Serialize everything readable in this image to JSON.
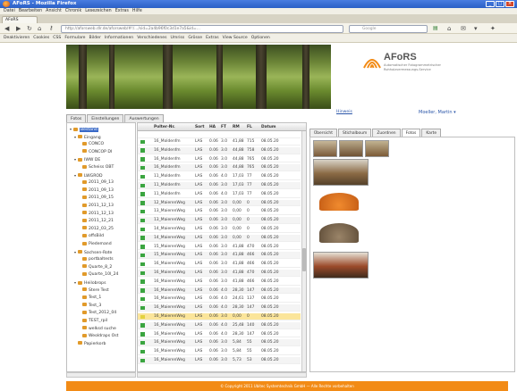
{
  "browser": {
    "title": "AFoRS - Mozilla Firefox",
    "menu": [
      "Datei",
      "Bearbeiten",
      "Ansicht",
      "Chronik",
      "Lesezeichen",
      "Extras",
      "Hilfe"
    ],
    "tab_label": "AFoRS",
    "url": "http://aforsweb.dlr.de/aforsweb/#!/.../sid=2a4b96f0c3d1e7a5&id=...",
    "search_placeholder": "Google",
    "bookmarks": [
      "Deaktivieren",
      "Cookies",
      "CSS",
      "Formulare",
      "Bilder",
      "Informationen",
      "Verschiedenes",
      "Umriss",
      "Grösse",
      "Extras",
      "View Source",
      "Optionen"
    ]
  },
  "header": {
    "logo_name": "AFoRS",
    "logo_sub": "Automatischer Fotogrammetrischer Rohholzvermessungs-Service",
    "small_link": "Hinweis",
    "user": "Moeller, Martin ▾"
  },
  "nav_tabs": [
    "Fotos",
    "Einstellungen",
    "Auswertungen"
  ],
  "tree": [
    {
      "label": "Bestand",
      "indent": 0,
      "selected": true,
      "expanded": true
    },
    {
      "label": "Eingang",
      "indent": 1,
      "expanded": true
    },
    {
      "label": "CONCO",
      "indent": 2
    },
    {
      "label": "CONCOP DI",
      "indent": 2
    },
    {
      "label": "IWW DE",
      "indent": 1,
      "expanded": true
    },
    {
      "label": "Scheiss OBT",
      "indent": 2
    },
    {
      "label": "LWGROD",
      "indent": 1,
      "expanded": true
    },
    {
      "label": "2011_09_13",
      "indent": 2
    },
    {
      "label": "2011_09_13",
      "indent": 2
    },
    {
      "label": "2011_09_15",
      "indent": 2
    },
    {
      "label": "2011_12_13",
      "indent": 2
    },
    {
      "label": "2011_12_13",
      "indent": 2
    },
    {
      "label": "2011_12_21",
      "indent": 2
    },
    {
      "label": "2012_03_25",
      "indent": 2
    },
    {
      "label": "offsBild",
      "indent": 2
    },
    {
      "label": "Piedemand",
      "indent": 2
    },
    {
      "label": "Sachsen-Rote",
      "indent": 1,
      "expanded": true
    },
    {
      "label": "portbaltests",
      "indent": 2
    },
    {
      "label": "Quarte_8_2",
      "indent": 2
    },
    {
      "label": "Quarte_10l_24",
      "indent": 2
    },
    {
      "label": "Heilobrops",
      "indent": 1,
      "expanded": true
    },
    {
      "label": "Stere Test",
      "indent": 2
    },
    {
      "label": "Test_1",
      "indent": 2
    },
    {
      "label": "Test_3",
      "indent": 2
    },
    {
      "label": "Test_2012_04",
      "indent": 2
    },
    {
      "label": "TEST_rpil",
      "indent": 2
    },
    {
      "label": "welksd suche",
      "indent": 2
    },
    {
      "label": "Weoldraps Ost",
      "indent": 2
    },
    {
      "label": "Papierkorb",
      "indent": 1
    }
  ],
  "grid": {
    "columns": [
      "Polter-Nr.",
      "Sort",
      "HA",
      "FT",
      "RM",
      "FL",
      "Datum"
    ],
    "rows": [
      {
        "name": "16_Moldenfm",
        "sort": "LAS",
        "ha": "0.06",
        "ft": "3.0",
        "rm": "41,88",
        "fl": "715",
        "date": "08.05.20",
        "color": "green"
      },
      {
        "name": "16_Moldenfm",
        "sort": "LAS",
        "ha": "0.06",
        "ft": "3.0",
        "rm": "44,88",
        "fl": "758",
        "date": "08.05.20",
        "color": "green"
      },
      {
        "name": "16_Moldenfm",
        "sort": "LAS",
        "ha": "0.06",
        "ft": "3.0",
        "rm": "44,88",
        "fl": "765",
        "date": "08.05.20",
        "color": "green"
      },
      {
        "name": "16_Moldenfm",
        "sort": "LAS",
        "ha": "0.06",
        "ft": "3.0",
        "rm": "44,88",
        "fl": "765",
        "date": "08.05.20",
        "color": "green"
      },
      {
        "name": "11_Moldenfm",
        "sort": "LAS",
        "ha": "0.06",
        "ft": "4.0",
        "rm": "17,03",
        "fl": "77",
        "date": "08.05.20",
        "color": "green"
      },
      {
        "name": "11_Moldenfm",
        "sort": "LAS",
        "ha": "0.06",
        "ft": "3.0",
        "rm": "17,03",
        "fl": "77",
        "date": "08.05.20",
        "color": "green"
      },
      {
        "name": "11_Moldenfm",
        "sort": "LAS",
        "ha": "0.06",
        "ft": "4.0",
        "rm": "17,03",
        "fl": "77",
        "date": "08.05.20",
        "color": "green"
      },
      {
        "name": "12_MaierenWeg",
        "sort": "LAS",
        "ha": "0.06",
        "ft": "3.0",
        "rm": "0,00",
        "fl": "0",
        "date": "08.05.20",
        "color": "green"
      },
      {
        "name": "13_MaierenWeg",
        "sort": "LAS",
        "ha": "0.06",
        "ft": "3.0",
        "rm": "0,00",
        "fl": "0",
        "date": "08.05.20",
        "color": "green"
      },
      {
        "name": "13_MaierenWeg",
        "sort": "LAS",
        "ha": "0.06",
        "ft": "3.0",
        "rm": "0,00",
        "fl": "0",
        "date": "08.05.20",
        "color": "green"
      },
      {
        "name": "14_MaierenWeg",
        "sort": "LAS",
        "ha": "0.06",
        "ft": "3.0",
        "rm": "0,00",
        "fl": "0",
        "date": "08.05.20",
        "color": "green"
      },
      {
        "name": "14_MaierenWeg",
        "sort": "LAS",
        "ha": "0.06",
        "ft": "3.0",
        "rm": "0,00",
        "fl": "0",
        "date": "08.05.20",
        "color": "green"
      },
      {
        "name": "15_MaierenWeg",
        "sort": "LAS",
        "ha": "0.06",
        "ft": "3.0",
        "rm": "41,88",
        "fl": "470",
        "date": "08.05.20",
        "color": "green"
      },
      {
        "name": "15_MaierenWeg",
        "sort": "LAS",
        "ha": "0.06",
        "ft": "3.0",
        "rm": "41,88",
        "fl": "466",
        "date": "08.05.20",
        "color": "green"
      },
      {
        "name": "16_MaierenWeg",
        "sort": "LAS",
        "ha": "0.06",
        "ft": "3.0",
        "rm": "41,88",
        "fl": "466",
        "date": "08.05.20",
        "color": "green"
      },
      {
        "name": "16_MaierenWeg",
        "sort": "LAS",
        "ha": "0.06",
        "ft": "3.0",
        "rm": "41,88",
        "fl": "470",
        "date": "08.05.20",
        "color": "green"
      },
      {
        "name": "16_MaierenWeg",
        "sort": "LAS",
        "ha": "0.06",
        "ft": "3.0",
        "rm": "41,88",
        "fl": "466",
        "date": "08.05.20",
        "color": "green"
      },
      {
        "name": "16_MaierenWeg",
        "sort": "LAS",
        "ha": "0.06",
        "ft": "4.0",
        "rm": "28,30",
        "fl": "147",
        "date": "08.05.20",
        "color": "green"
      },
      {
        "name": "16_MaierenWeg",
        "sort": "LAS",
        "ha": "0.06",
        "ft": "4.0",
        "rm": "24,61",
        "fl": "137",
        "date": "08.05.20",
        "color": "green"
      },
      {
        "name": "16_MaierenWeg",
        "sort": "LAS",
        "ha": "0.06",
        "ft": "4.0",
        "rm": "28,30",
        "fl": "147",
        "date": "08.05.20",
        "color": "green"
      },
      {
        "name": "16_MaierenWeg",
        "sort": "LAS",
        "ha": "0.06",
        "ft": "3.0",
        "rm": "0,00",
        "fl": "0",
        "date": "08.05.20",
        "color": "yellow",
        "selected": true
      },
      {
        "name": "16_MaierenWeg",
        "sort": "LAS",
        "ha": "0.06",
        "ft": "4.0",
        "rm": "25,48",
        "fl": "140",
        "date": "08.05.20",
        "color": "green"
      },
      {
        "name": "16_MaierenWeg",
        "sort": "LAS",
        "ha": "0.06",
        "ft": "4.0",
        "rm": "28,30",
        "fl": "147",
        "date": "08.05.20",
        "color": "green"
      },
      {
        "name": "16_MaierenWeg",
        "sort": "LAS",
        "ha": "0.06",
        "ft": "3.0",
        "rm": "5,84",
        "fl": "55",
        "date": "08.05.20",
        "color": "green"
      },
      {
        "name": "16_MaierenWeg",
        "sort": "LAS",
        "ha": "0.06",
        "ft": "3.0",
        "rm": "5,84",
        "fl": "55",
        "date": "08.05.20",
        "color": "green"
      },
      {
        "name": "16_MaierenWeg",
        "sort": "LAS",
        "ha": "0.06",
        "ft": "3.0",
        "rm": "5,73",
        "fl": "53",
        "date": "08.05.20",
        "color": "green"
      }
    ]
  },
  "right_tabs": [
    "Übersicht",
    "Stichalboum",
    "Zuordnen",
    "Fotos",
    "Karte"
  ],
  "footer": "© Copyright 2011 Ubitec Systemtechnik GmbH — Alle Rechte vorbehalten"
}
